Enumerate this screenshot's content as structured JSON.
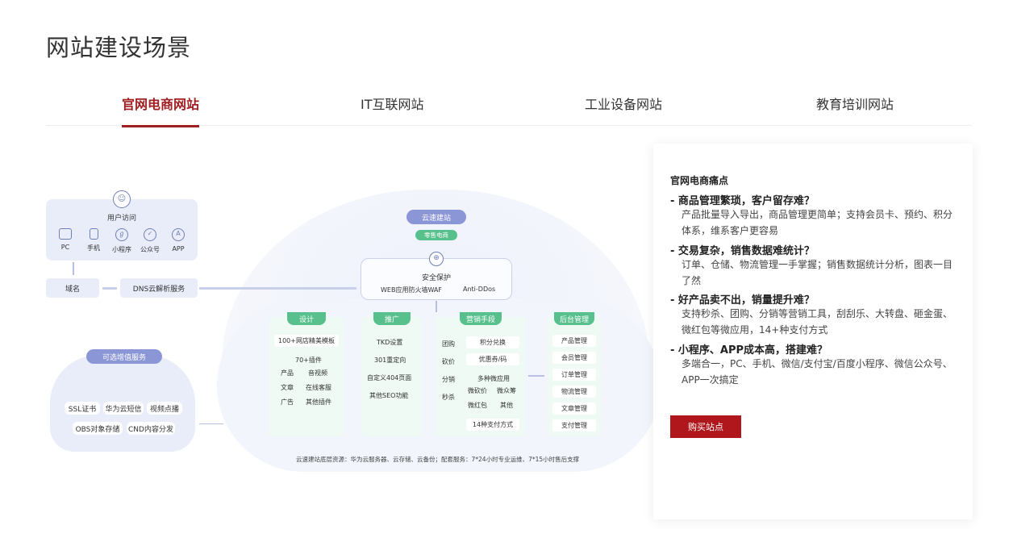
{
  "page_title": "网站建设场景",
  "tabs": [
    {
      "label": "官网电商网站"
    },
    {
      "label": "IT互联网站"
    },
    {
      "label": "工业设备网站"
    },
    {
      "label": "教育培训网站"
    }
  ],
  "diagram": {
    "user_access": {
      "label": "用户访问",
      "items": [
        "PC",
        "手机",
        "小程序",
        "公众号",
        "APP"
      ]
    },
    "domain": "域名",
    "dns": "DNS云解析服务",
    "addon": {
      "title": "可选增值服务",
      "items": [
        "SSL证书",
        "华为云短信",
        "视频点播",
        "OBS对象存储",
        "CND内容分发"
      ]
    },
    "cloud_label": "云速建站",
    "cloud_sub": "零售电商",
    "security": {
      "title": "安全保护",
      "a": "WEB应用防火墙WAF",
      "b": "Anti-DDos"
    },
    "columns": {
      "design": {
        "head": "设计",
        "template": "100+网店精美模板",
        "plugins_title": "70+插件",
        "plugins": [
          "产品",
          "音视频",
          "文章",
          "在线客服",
          "广告",
          "其他插件"
        ]
      },
      "promo": {
        "head": "推广",
        "items": [
          "TKD设置",
          "301重定向",
          "自定义404页面",
          "其他SEO功能"
        ]
      },
      "marketing": {
        "head": "营销手段",
        "left": [
          "团购",
          "砍价",
          "分销",
          "秒杀"
        ],
        "points": "积分兑换",
        "coupon": "优惠券/码",
        "multi_title": "多种微应用",
        "multi": [
          "微砍价",
          "微众筹",
          "微红包",
          "其他"
        ],
        "pay": "14种支付方式"
      },
      "admin": {
        "head": "后台管理",
        "items": [
          "产品管理",
          "会员管理",
          "订单管理",
          "物流管理",
          "文章管理",
          "支付管理"
        ]
      }
    },
    "bottom_note": "云速建站底层资源：华为云服务器、云存储、云备份；配套服务：7*24小时专业运维、7*15小时售后支撑"
  },
  "card": {
    "title": "官网电商痛点",
    "points": [
      {
        "title": "- 商品管理繁琐，客户留存难？",
        "desc": "产品批量导入导出，商品管理更简单；支持会员卡、预约、积分体系，维系客户更容易"
      },
      {
        "title": "- 交易复杂，销售数据难统计？",
        "desc": "订单、仓储、物流管理一手掌握；销售数据统计分析，图表一目了然"
      },
      {
        "title": "- 好产品卖不出，销量提升难？",
        "desc": "支持秒杀、团购、分销等营销工具，刮刮乐、大转盘、砸金蛋、微红包等微应用，14+种支付方式"
      },
      {
        "title": "- 小程序、APP成本高，搭建难？",
        "desc": "多端合一，PC、手机、微信/支付宝/百度小程序、微信公众号、APP一次搞定"
      }
    ],
    "buy_label": "购买站点"
  },
  "colors": {
    "accent": "#a01f23",
    "button": "#b0171c",
    "green": "#58c08c",
    "purple": "#8b96d6"
  }
}
